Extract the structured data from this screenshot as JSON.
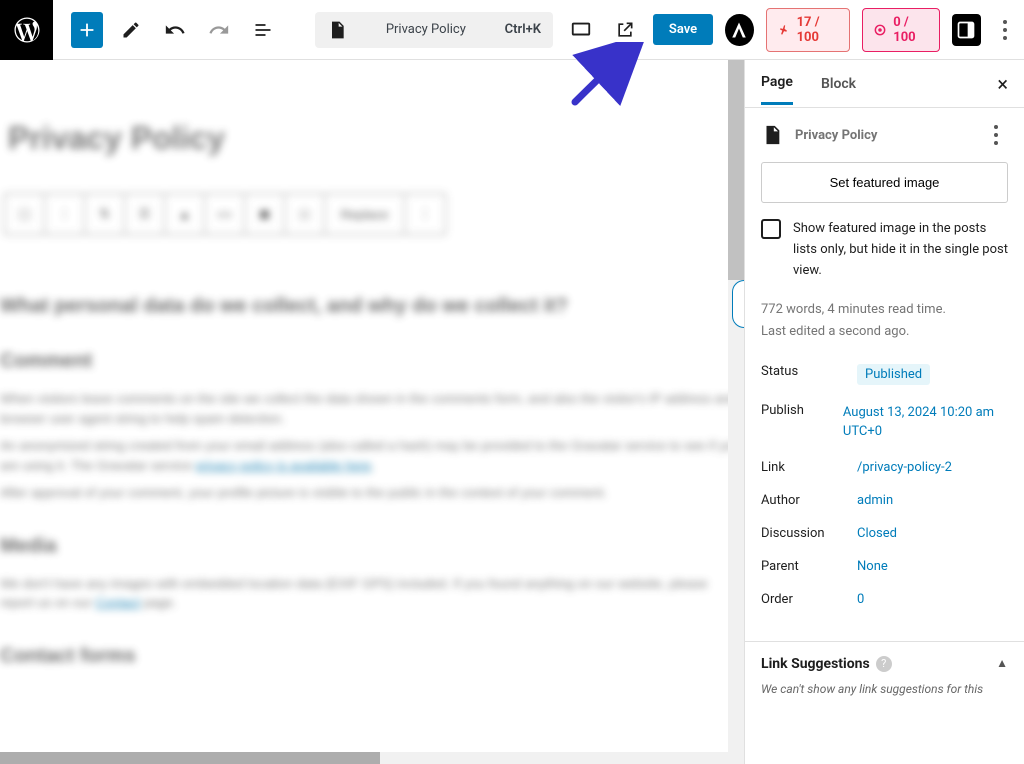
{
  "toolbar": {
    "doc_title": "Privacy Policy",
    "shortcut": "Ctrl+K",
    "save_label": "Save"
  },
  "scores": {
    "seo": "17 / 100",
    "readability": "0 / 100"
  },
  "editor": {
    "h1": "Privacy Policy",
    "replace": "Replace",
    "h2a": "What personal data do we collect, and why do we collect it?",
    "h2b": "Comment",
    "p1": "When visitors leave comments on the site we collect the data shown in the comments form, and also the visitor's IP address and browser user agent string to help spam detection.",
    "p2a": "An anonymized string created from your email address (also called a hash) may be provided to the Gravatar service to see if you are using it. The Gravatar service ",
    "p2link": "privacy policy is available here",
    "p3": "After approval of your comment, your profile picture is visible to the public in the context of your comment.",
    "h2c": "Media",
    "p4a": "We don't have any images with embedded location data (EXIF GPS) included. If you found anything on our website, please report us on our ",
    "p4link": "Contact",
    "p4b": " page.",
    "h2d": "Contact forms"
  },
  "sidebar": {
    "tabs": {
      "page": "Page",
      "block": "Block"
    },
    "template_name": "Privacy Policy",
    "featured_img_btn": "Set featured image",
    "chk_label": "Show featured image in the posts lists only, but hide it in the single post view.",
    "meta_words": "772 words, 4 minutes read time.",
    "meta_edited": "Last edited a second ago.",
    "kv": {
      "status_k": "Status",
      "status_v": "Published",
      "publish_k": "Publish",
      "publish_v": "August 13, 2024 10:20 am UTC+0",
      "link_k": "Link",
      "link_v": "/privacy-policy-2",
      "author_k": "Author",
      "author_v": "admin",
      "discussion_k": "Discussion",
      "discussion_v": "Closed",
      "parent_k": "Parent",
      "parent_v": "None",
      "order_k": "Order",
      "order_v": "0"
    },
    "link_sugg_title": "Link Suggestions",
    "link_sugg_body": "We can't show any link suggestions for this"
  }
}
